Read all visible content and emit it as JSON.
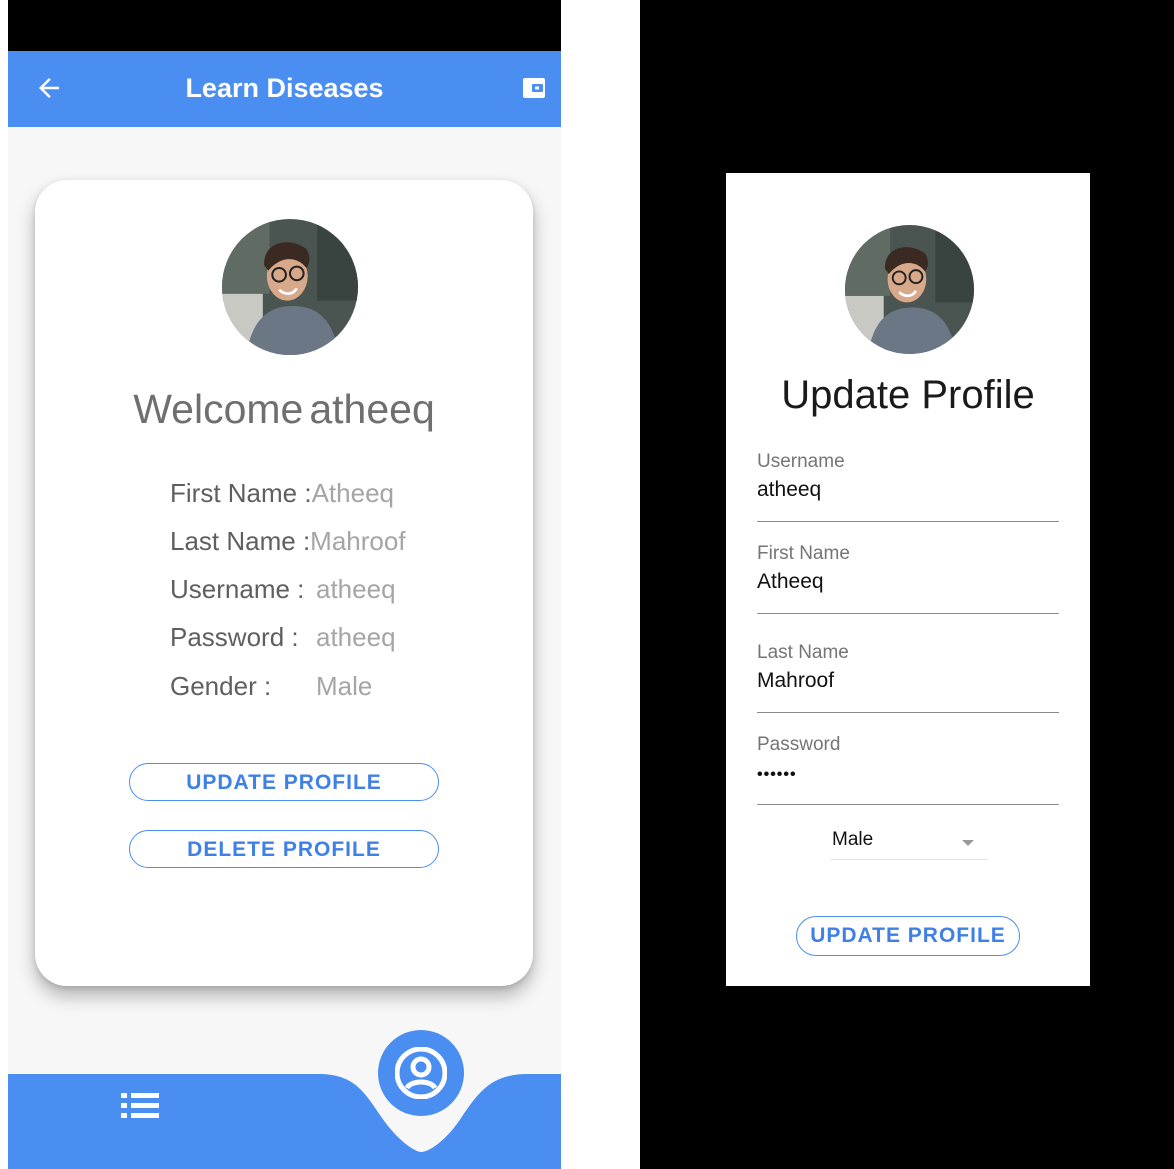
{
  "left_screen": {
    "app_bar": {
      "title": "Learn Diseases",
      "back_icon": "arrow-left-icon",
      "action_icon": "wallet-icon",
      "color": "#4a8ef2"
    },
    "card": {
      "welcome_word": "Welcome",
      "welcome_name": "atheeq",
      "rows": [
        {
          "label": "First Name :",
          "value": "Atheeq"
        },
        {
          "label": "Last Name :",
          "value": "Mahroof"
        },
        {
          "label": "Username  :",
          "value": "atheeq"
        },
        {
          "label": "Password  :",
          "value": "atheeq"
        },
        {
          "label": "Gender     :",
          "value": "Male"
        }
      ],
      "update_button": "UPDATE PROFILE",
      "delete_button": "DELETE PROFILE"
    },
    "bottom_nav": {
      "list_icon": "list-icon",
      "profile_icon": "account-circle-icon",
      "color": "#4a8ef2"
    }
  },
  "right_screen": {
    "title": "Update Profile",
    "fields": [
      {
        "label": "Username",
        "value": "atheeq"
      },
      {
        "label": "First Name",
        "value": "Atheeq"
      },
      {
        "label": "Last Name",
        "value": "Mahroof"
      },
      {
        "label": "Password",
        "value": "••••••"
      }
    ],
    "gender_select": {
      "value": "Male"
    },
    "update_button": "UPDATE PROFILE"
  }
}
